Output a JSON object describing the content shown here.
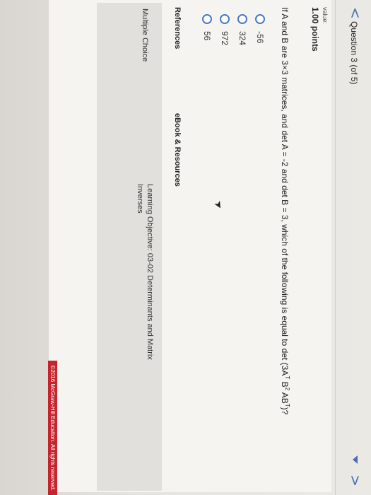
{
  "nav": {
    "back_glyph": "<",
    "next_glyph": ">",
    "question_title": "Question 3 (of 5)"
  },
  "value": {
    "label": "value:",
    "points": "1.00 points"
  },
  "question": {
    "text_before": "If A and B are 3×3 matrices, and det A = -2 and det B = 3, which of the following is equal to det (3A",
    "sup1": "T",
    "text_mid1": " B",
    "sup2": "2",
    "text_mid2": " AB",
    "sup3": "T",
    "text_after": ")?"
  },
  "choices": [
    {
      "label": "-56",
      "selected": false
    },
    {
      "label": "324",
      "selected": false
    },
    {
      "label": "972",
      "selected": false
    },
    {
      "label": "56",
      "selected": false
    }
  ],
  "references": {
    "header_label": "References",
    "ebook_header_label": "eBook & Resources",
    "type_label": "Multiple Choice",
    "objective_text": "Learning Objective: 03-02 Determinants and Matrix Inverses"
  },
  "copyright": "©2016 McGraw-Hill Education. All rights reserved.",
  "colors": {
    "accent": "#4b78c4",
    "copyright_bar": "#c5242e"
  }
}
